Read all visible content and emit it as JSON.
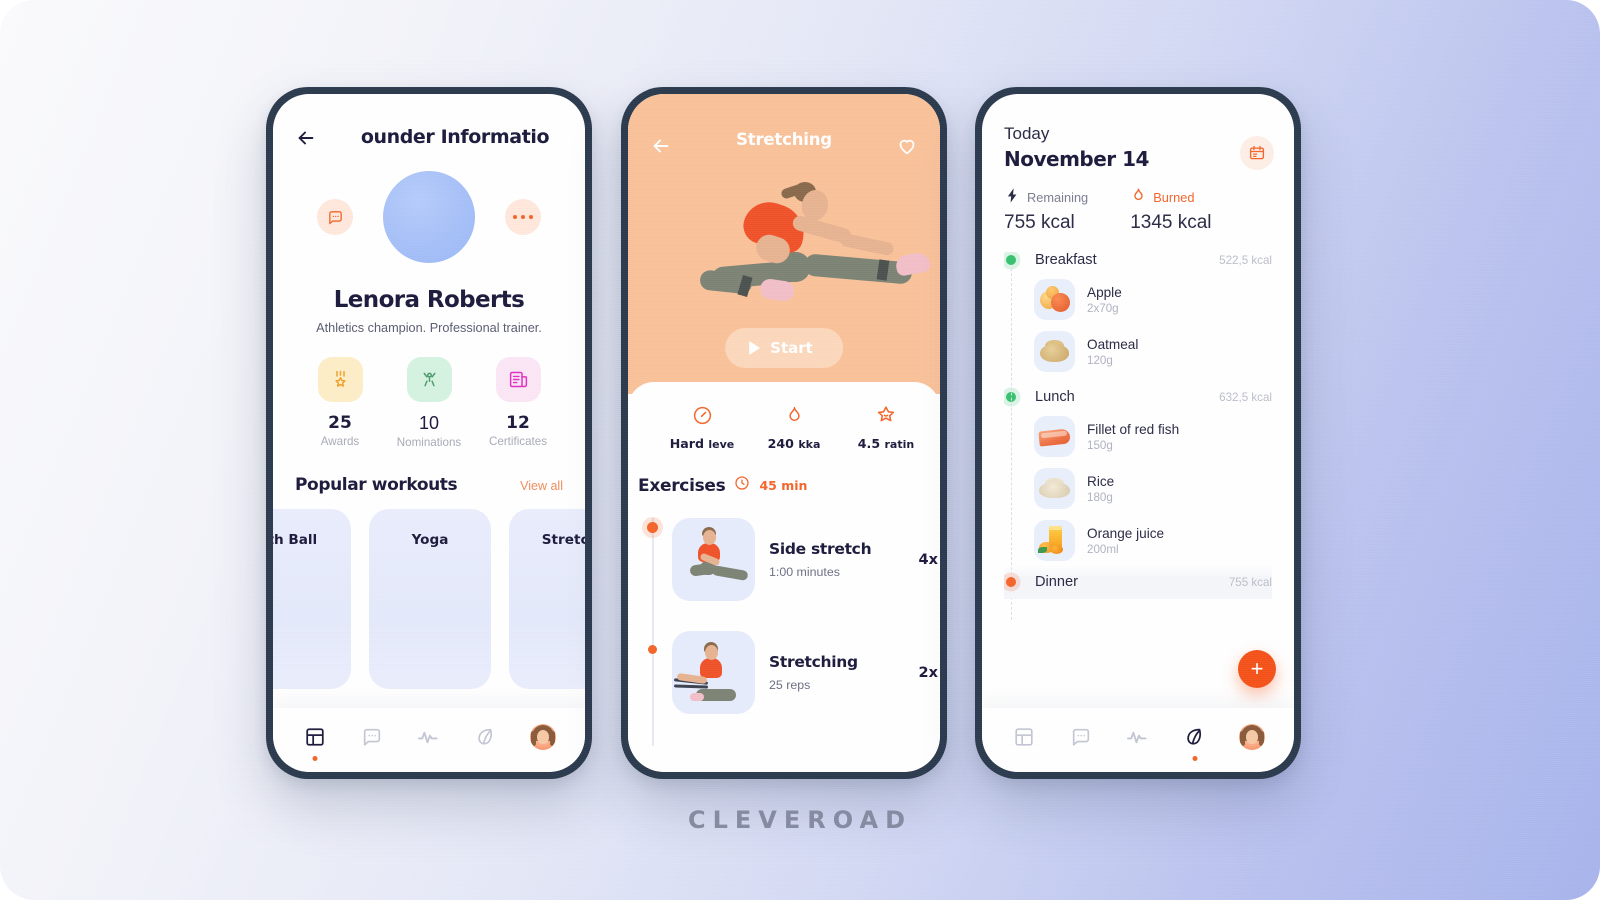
{
  "brand": "CLEVEROAD",
  "colors": {
    "accent_orange": "#f4652a",
    "dark_navy": "#1d1b3d",
    "frame": "#2c3a4f",
    "hero_peach": "#f9c29a",
    "green": "#37c16e",
    "card_blue": "#e6ecfc"
  },
  "phone1": {
    "header": {
      "title": "ounder Informatio",
      "back_icon": "back-arrow-icon"
    },
    "profile": {
      "message_icon": "message-bubble-icon",
      "more_icon": "more-dots-icon",
      "avatar": "user-avatar",
      "name": "Lenora Roberts",
      "bio": "Athletics champion. Professional trainer."
    },
    "stats": [
      {
        "icon": "medal-star-icon",
        "value": "25",
        "label": "Awards"
      },
      {
        "icon": "person-celebrate-icon",
        "value": "10",
        "label": "Nominations"
      },
      {
        "icon": "certificate-icon",
        "value": "12",
        "label": "Certificates"
      }
    ],
    "section": {
      "title": "Popular workouts",
      "action": "View all"
    },
    "workout_cards": [
      {
        "title": "ith Ball"
      },
      {
        "title": "Yoga"
      },
      {
        "title": "Stretch"
      }
    ],
    "tabs": [
      {
        "icon": "dashboard-grid-icon",
        "active": true
      },
      {
        "icon": "chat-bubble-icon",
        "active": false
      },
      {
        "icon": "activity-pulse-icon",
        "active": false
      },
      {
        "icon": "leaf-nutrition-icon",
        "active": false
      },
      {
        "icon": "profile-avatar-icon",
        "active": false
      }
    ]
  },
  "phone2": {
    "header": {
      "title": "Stretching",
      "back_icon": "back-arrow-icon",
      "favorite_icon": "heart-outline-icon"
    },
    "hero": {
      "image": "woman-side-stretch-photo",
      "start_label": "Start",
      "play_icon": "play-triangle-icon"
    },
    "metrics": [
      {
        "icon": "speedometer-icon",
        "value": "Hard",
        "unit": "leve"
      },
      {
        "icon": "flame-icon",
        "value": "240",
        "unit": "kka"
      },
      {
        "icon": "star-badge-icon",
        "value": "4.5",
        "unit": "ratin"
      }
    ],
    "exercises_header": {
      "title": "Exercises",
      "clock_icon": "clock-icon",
      "duration": "45 min"
    },
    "exercises": [
      {
        "thumb": "side-stretch-photo",
        "name": "Side stretch",
        "detail": "1:00 minutes",
        "reps": "4x"
      },
      {
        "thumb": "stretching-band-photo",
        "name": "Stretching",
        "detail": "25 reps",
        "reps": "2x"
      }
    ]
  },
  "phone3": {
    "header": {
      "today_label": "Today",
      "date": "November 14",
      "calendar_icon": "calendar-icon"
    },
    "summary": [
      {
        "icon": "lightning-bolt-icon",
        "label": "Remaining",
        "value": "755 kcal",
        "accent": false
      },
      {
        "icon": "flame-icon",
        "label": "Burned",
        "value": "1345 kcal",
        "accent": true
      }
    ],
    "meals": [
      {
        "name": "Breakfast",
        "kcal": "522,5 kcal",
        "status": "green",
        "items": [
          {
            "thumb": "apple-photo",
            "name": "Apple",
            "amount": "2x70g"
          },
          {
            "thumb": "oatmeal-photo",
            "name": "Oatmeal",
            "amount": "120g"
          }
        ]
      },
      {
        "name": "Lunch",
        "kcal": "632,5 kcal",
        "status": "green",
        "items": [
          {
            "thumb": "salmon-fillet-photo",
            "name": "Fillet of red fish",
            "amount": "150g"
          },
          {
            "thumb": "rice-photo",
            "name": "Rice",
            "amount": "180g"
          },
          {
            "thumb": "orange-juice-photo",
            "name": "Orange juice",
            "amount": "200ml"
          }
        ]
      },
      {
        "name": "Dinner",
        "kcal": "755 kcal",
        "status": "orange",
        "items": []
      }
    ],
    "fab": {
      "icon": "plus-icon",
      "label": "+"
    },
    "tabs": [
      {
        "icon": "dashboard-grid-icon",
        "active": false
      },
      {
        "icon": "chat-bubble-icon",
        "active": false
      },
      {
        "icon": "activity-pulse-icon",
        "active": false
      },
      {
        "icon": "leaf-nutrition-icon",
        "active": true
      },
      {
        "icon": "profile-avatar-icon",
        "active": false
      }
    ]
  }
}
